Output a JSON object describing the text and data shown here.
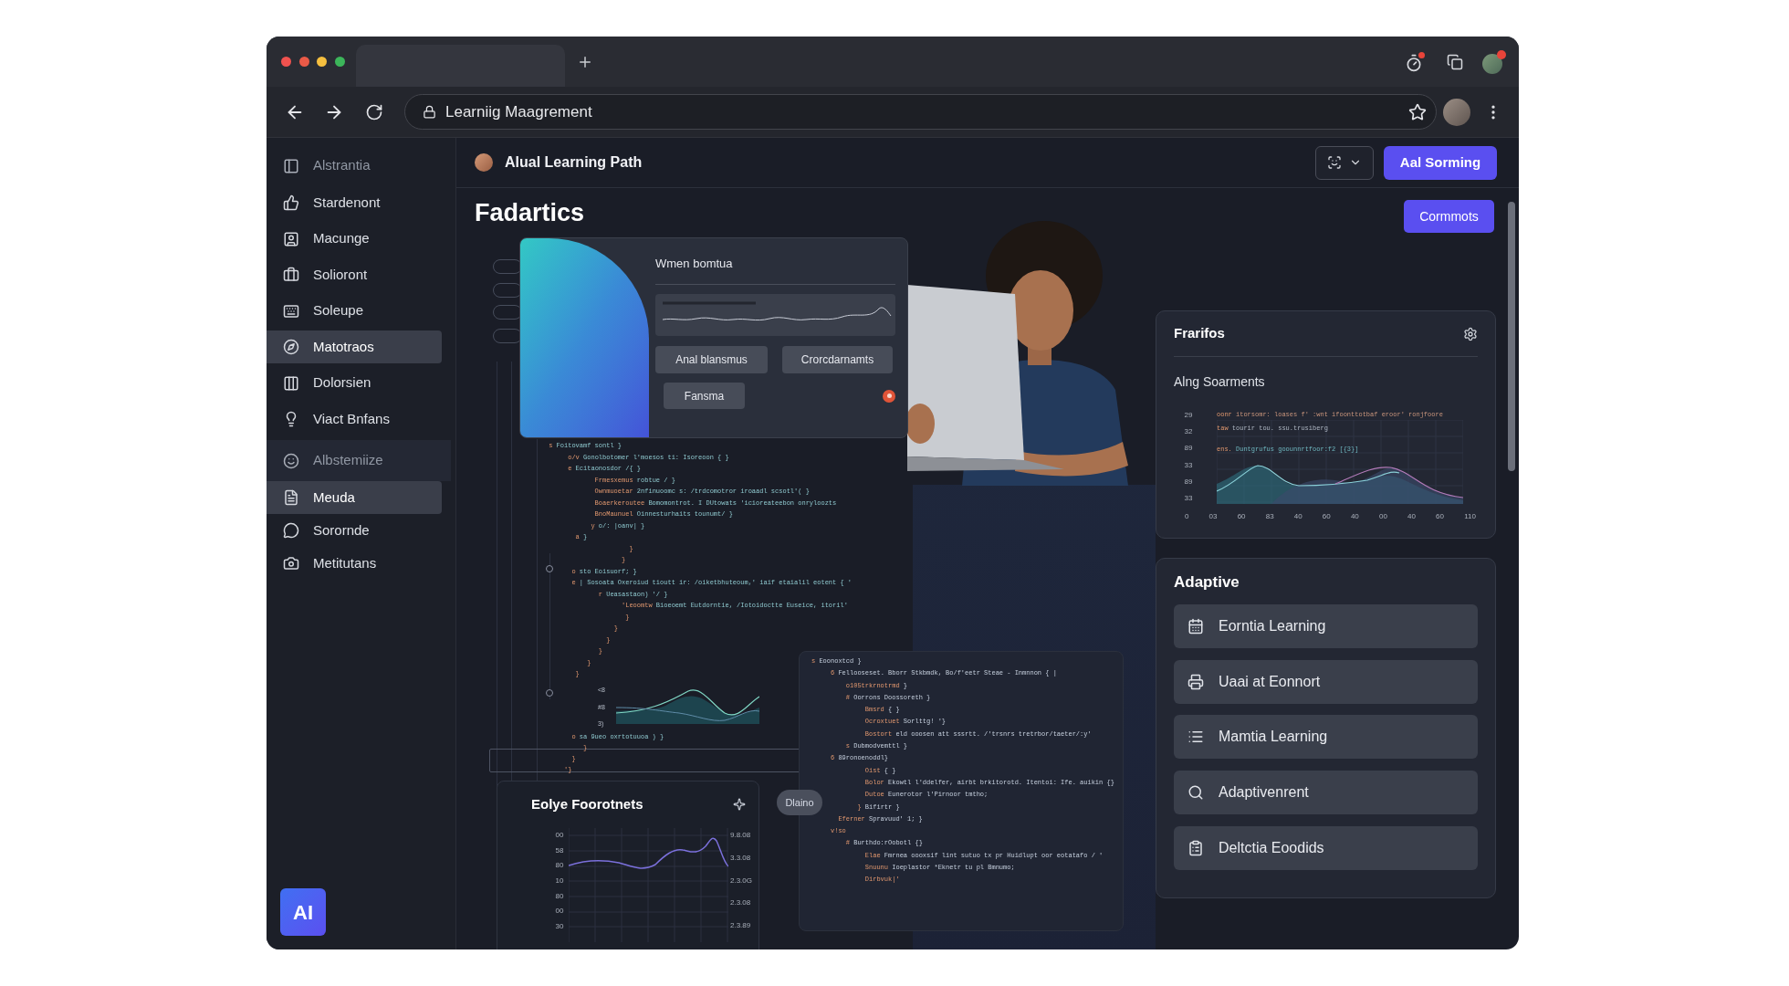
{
  "browser": {
    "address_bar": {
      "url": "Learniig Maagrement"
    }
  },
  "app_header": {
    "title": "Alual Learning Path",
    "primary_button": "Aal Sorming"
  },
  "sidebar": {
    "sections": [
      {
        "label": "Alstrantia",
        "expanded": false,
        "items": [
          {
            "label": "Stardenont",
            "selected": false
          },
          {
            "label": "Macunge",
            "selected": false
          },
          {
            "label": "Solioront",
            "selected": false
          },
          {
            "label": "Soleupe",
            "selected": false
          },
          {
            "label": "Matotraos",
            "selected": true
          },
          {
            "label": "Dolorsien",
            "selected": false
          },
          {
            "label": "Viact Bnfans",
            "selected": false
          }
        ]
      },
      {
        "label": "Albstemiize",
        "expanded": true,
        "items": [
          {
            "label": "Meuda",
            "selected": true
          },
          {
            "label": "Sorornde",
            "selected": false
          },
          {
            "label": "Metitutans",
            "selected": false
          }
        ]
      }
    ],
    "logo": "AI"
  },
  "page": {
    "title": "Fadartics",
    "action_button": "Cormmots"
  },
  "profile_card": {
    "title": "Wmen bomtua",
    "buttons": [
      "Anal blansmus",
      "Crorcdarnamts",
      "Fansma"
    ]
  },
  "insights_card": {
    "title": "Frarifos",
    "subtitle": "Alng Soarments",
    "overlay_lines": [
      "oonr itorsomr: loases f' :wnt ifoonttotbaf eroor' ronjfoore",
      "taw tourir tou. ssu.trusiberg",
      "ens. Duntgrufus goounnrtfoor:f2 [{3}]"
    ],
    "y_ticks": [
      "29",
      "32",
      "89",
      "33",
      "89",
      "33"
    ],
    "x_ticks": [
      "0",
      "03",
      "60",
      "83",
      "40",
      "60",
      "40",
      "00",
      "40",
      "60",
      "110"
    ]
  },
  "code_editor": {
    "lines_top": [
      " s Foitovamf sontl }",
      "      o/v Gonolbotomer l'moesos ti: Isoreoon { }",
      "      e Ecitaonosdor /{ }",
      "             Frmesxemus robtue / }",
      "             Ownmuoetar 2nfinuoomc s: /trdcomotror iroaadl scsotl'( }",
      "             Boaerkeroutee Bomomontrot. I DUtowats 'icioreateebon onryloozts",
      "             BnoMaunuel Oinnesturhaits tounumt/ }",
      "            y o/: |oanv| }",
      "        a }",
      "                      }",
      "                    }",
      "       o sto Eoisuorf; }",
      "       e | Sosoata Oxeroiud tioutt ir: /oiketbhuteoum,' iaif etaialil eotent { '",
      "              r Ueasastaon) '/ }",
      "                    'Leoomtw Bioeoemt Eutdorntie, /Iotoidoctte Euseice, itoril'",
      "                     }",
      "                  }",
      "                }",
      "              }",
      "           }",
      "        }"
    ],
    "mini_chart_labels": [
      "<8",
      "#8",
      "3)"
    ],
    "lines_bottom": [
      "       o sa 9ueo oxrtotuuoa ) }",
      "          }",
      "       }",
      "     '}"
    ]
  },
  "adaptive_card": {
    "title": "Adaptive",
    "items": [
      "Eorntia Learning",
      "Uaai at Eonnort",
      "Mamtia Learning",
      "Adaptivenrent",
      "Deltctia Eoodids"
    ]
  },
  "code_panel": {
    "lines": [
      "s Eoonoxtcd }",
      "     6 Fellooseset. Bborr Stkbmdk, Bo/f'eetr Steae - Inmnnon { |",
      "         o105trkrnotrmd }",
      "         # Oorrons Doossoreth }",
      "              Bmsrd { }",
      "              Ocroxtuet Sorlttg! '}",
      "              Bostort eld ooosen att sssrtt. /'trsnrs tretrbor/taeter/:y'",
      "         s Dubmodvemttl }",
      "     6 89ronoenoddl}",
      "              Oist { }",
      "              Bolor Ekowtl l'ddelfer, airbt brkitorotd. Itentoi: Ife. auikin {}",
      "              Dutoe Eunerotor l'Pirnoor tmtho;",
      "            } Bifirtr }",
      "       Eferner Spravuud' 1; }",
      "     v!so",
      "         # Burthdo:rOobotl {}",
      "              Elae Fmrnea oooxsif lint sutuo tx pr Huidlupt oor eotatafo / '",
      "              Snuunu Ioeplastor *Eknetr tu pl Bmnumo;",
      "              Dirbvuk|'"
    ]
  },
  "chart_card": {
    "title": "Eolye Foorotnets",
    "left_labels": [
      "00",
      "58",
      "80",
      "10",
      "80",
      "00",
      "30"
    ],
    "right_labels": [
      "9.8.08",
      "3.3.08",
      "2.3.0G",
      "2.3.08",
      "2.3.89"
    ]
  },
  "status_pill": "Dlaino"
}
